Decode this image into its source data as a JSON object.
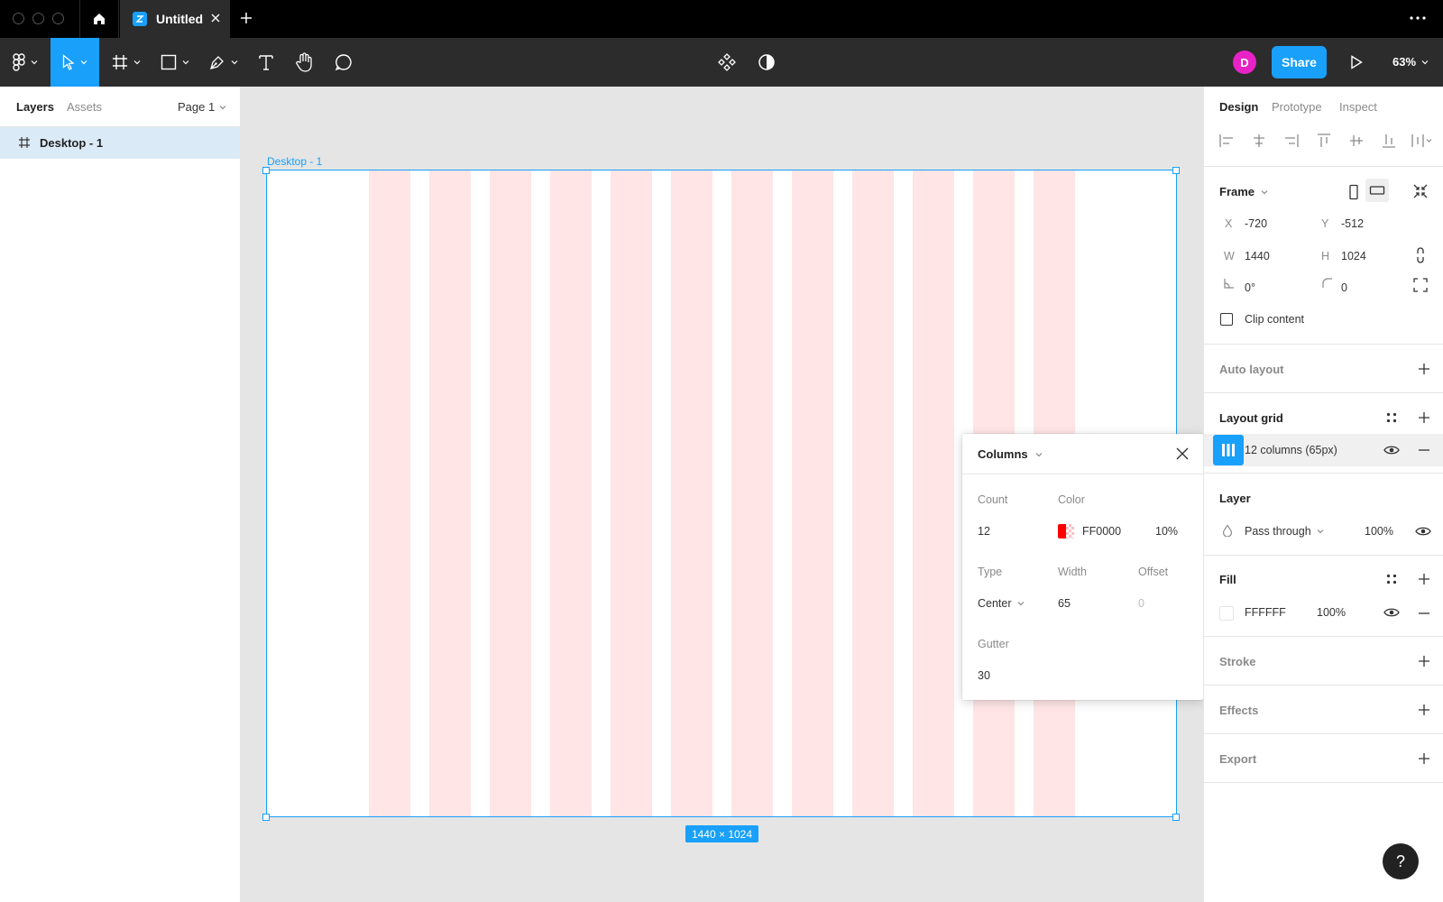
{
  "titlebar": {
    "tab_title": "Untitled"
  },
  "toolbar": {
    "avatar_initial": "D",
    "share_label": "Share",
    "zoom": "63%"
  },
  "left_panel": {
    "tabs": [
      "Layers",
      "Assets"
    ],
    "page": "Page 1",
    "layers": [
      {
        "name": "Desktop - 1",
        "selected": true
      }
    ]
  },
  "canvas": {
    "frame_name": "Desktop - 1",
    "size_badge": "1440 × 1024",
    "grid_column_count": 12,
    "grid_color": "#FF0000",
    "grid_opacity": 0.1
  },
  "popover": {
    "title": "Columns",
    "count_label": "Count",
    "count": "12",
    "color_label": "Color",
    "color_hex": "FF0000",
    "color_opacity": "10%",
    "type_label": "Type",
    "type": "Center",
    "width_label": "Width",
    "width": "65",
    "offset_label": "Offset",
    "offset": "0",
    "gutter_label": "Gutter",
    "gutter": "30"
  },
  "right_panel": {
    "tabs": [
      "Design",
      "Prototype",
      "Inspect"
    ],
    "frame": {
      "title": "Frame",
      "x_label": "X",
      "x": "-720",
      "y_label": "Y",
      "y": "-512",
      "w_label": "W",
      "w": "1440",
      "h_label": "H",
      "h": "1024",
      "rotation": "0°",
      "radius": "0",
      "clip_content": "Clip content"
    },
    "auto_layout": "Auto layout",
    "layout_grid": {
      "title": "Layout grid",
      "item": "12 columns (65px)"
    },
    "layer": {
      "title": "Layer",
      "blend": "Pass through",
      "opacity": "100%"
    },
    "fill": {
      "title": "Fill",
      "hex": "FFFFFF",
      "opacity": "100%"
    },
    "stroke": "Stroke",
    "effects": "Effects",
    "export": "Export"
  },
  "colors": {
    "accent": "#18A0FB",
    "toolbar": "#2C2C2C",
    "avatar": "#E822C7"
  },
  "help_label": "?"
}
